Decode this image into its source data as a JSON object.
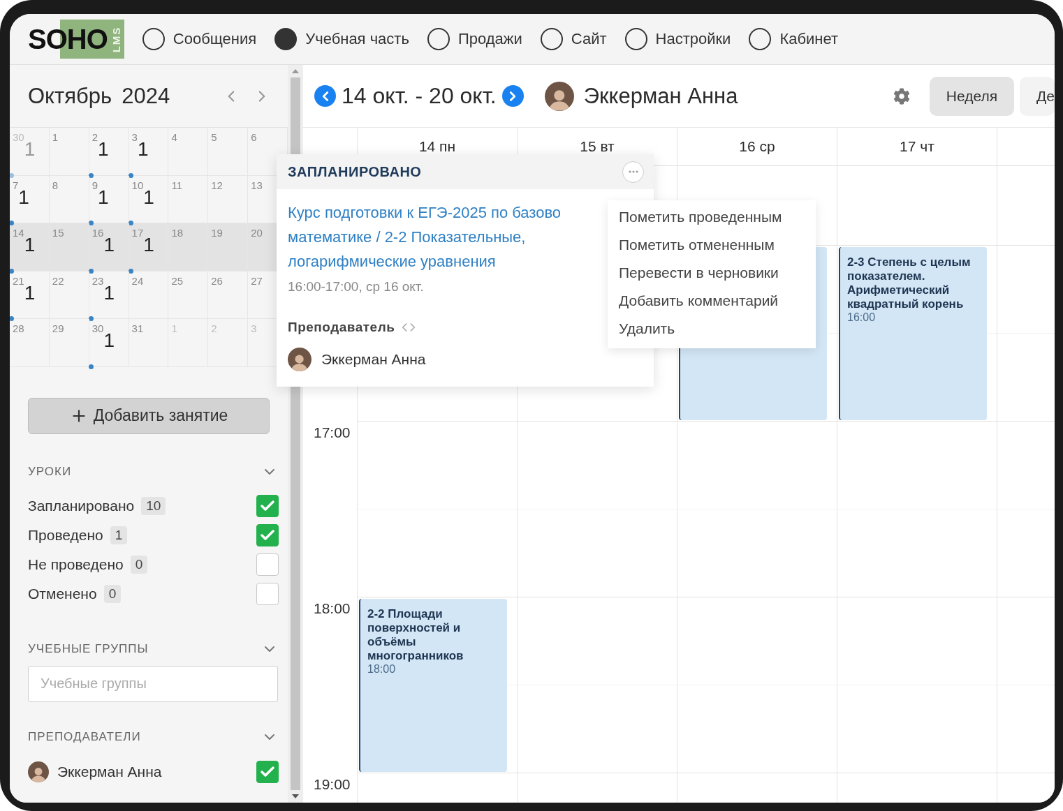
{
  "nav": {
    "logo": "SOHO",
    "logo_sub": "LMS",
    "items": [
      {
        "label": "Сообщения",
        "selected": false
      },
      {
        "label": "Учебная часть",
        "selected": true
      },
      {
        "label": "Продажи",
        "selected": false
      },
      {
        "label": "Сайт",
        "selected": false
      },
      {
        "label": "Настройки",
        "selected": false
      },
      {
        "label": "Кабинет",
        "selected": false
      }
    ]
  },
  "sidebar": {
    "month": "Октябрь",
    "year": "2024",
    "weeks": [
      {
        "selected": false,
        "days": [
          {
            "day": "30",
            "outside": true,
            "count": "1"
          },
          {
            "day": "1",
            "outside": false
          },
          {
            "day": "2",
            "outside": false,
            "count": "1"
          },
          {
            "day": "3",
            "outside": false,
            "count": "1"
          },
          {
            "day": "4",
            "outside": false
          },
          {
            "day": "5",
            "outside": false
          },
          {
            "day": "6",
            "outside": false
          }
        ]
      },
      {
        "selected": false,
        "days": [
          {
            "day": "7",
            "outside": false,
            "count": "1"
          },
          {
            "day": "8",
            "outside": false
          },
          {
            "day": "9",
            "outside": false,
            "count": "1"
          },
          {
            "day": "10",
            "outside": false,
            "count": "1"
          },
          {
            "day": "11",
            "outside": false
          },
          {
            "day": "12",
            "outside": false
          },
          {
            "day": "13",
            "outside": false
          }
        ]
      },
      {
        "selected": true,
        "days": [
          {
            "day": "14",
            "outside": false,
            "count": "1"
          },
          {
            "day": "15",
            "outside": false
          },
          {
            "day": "16",
            "outside": false,
            "count": "1"
          },
          {
            "day": "17",
            "outside": false,
            "count": "1"
          },
          {
            "day": "18",
            "outside": false
          },
          {
            "day": "19",
            "outside": false
          },
          {
            "day": "20",
            "outside": false
          }
        ]
      },
      {
        "selected": false,
        "days": [
          {
            "day": "21",
            "outside": false,
            "count": "1"
          },
          {
            "day": "22",
            "outside": false
          },
          {
            "day": "23",
            "outside": false,
            "count": "1"
          },
          {
            "day": "24",
            "outside": false
          },
          {
            "day": "25",
            "outside": false
          },
          {
            "day": "26",
            "outside": false
          },
          {
            "day": "27",
            "outside": false
          }
        ]
      },
      {
        "selected": false,
        "days": [
          {
            "day": "28",
            "outside": false
          },
          {
            "day": "29",
            "outside": false
          },
          {
            "day": "30",
            "outside": false,
            "count": "1"
          },
          {
            "day": "31",
            "outside": false
          },
          {
            "day": "1",
            "outside": true
          },
          {
            "day": "2",
            "outside": true
          },
          {
            "day": "3",
            "outside": true
          }
        ]
      }
    ],
    "add_button": "Добавить занятие",
    "lessons": {
      "title": "УРОКИ",
      "filters": [
        {
          "label": "Запланировано",
          "count": "10",
          "checked": true
        },
        {
          "label": "Проведено",
          "count": "1",
          "checked": true
        },
        {
          "label": "Не проведено",
          "count": "0",
          "checked": false
        },
        {
          "label": "Отменено",
          "count": "0",
          "checked": false
        }
      ]
    },
    "groups": {
      "title": "УЧЕБНЫЕ ГРУППЫ",
      "placeholder": "Учебные группы"
    },
    "teachers": {
      "title": "ПРЕПОДАВАТЕЛИ",
      "items": [
        {
          "name": "Эккерман Анна",
          "checked": true
        }
      ]
    }
  },
  "header": {
    "range": "14 окт. - 20 окт.",
    "teacher": "Эккерман Анна",
    "views": [
      {
        "label": "Неделя",
        "selected": true
      },
      {
        "label": "Де",
        "selected": false
      }
    ]
  },
  "calendar": {
    "time_labels": [
      "17:00",
      "18:00",
      "19:00"
    ],
    "days": [
      {
        "label": "14 пн",
        "events": [
          {
            "title": "2-2 Площади поверхностей и объёмы многогранников",
            "time": "18:00",
            "kind": "text"
          }
        ]
      },
      {
        "label": "15 вт"
      },
      {
        "label": "16 ср",
        "events": [
          {
            "kind": "blank"
          }
        ]
      },
      {
        "label": "17 чт",
        "events": [
          {
            "title": "2-3 Степень с целым показателем. Арифметический квадратный корень",
            "time": "16:00",
            "kind": "text"
          }
        ]
      }
    ]
  },
  "popup": {
    "status": "ЗАПЛАНИРОВАНО",
    "title_lines": [
      "Курс подготовки к ЕГЭ-2025 по базово",
      "математике / 2-2 Показательные,",
      "логарифмические уравнения"
    ],
    "time": "16:00-17:00, ср 16 окт.",
    "teacher_label": "Преподаватель",
    "teacher": "Эккерман Анна"
  },
  "menu": [
    "Пометить проведенным",
    "Пометить отмененным",
    "Перевести в черновики",
    "Добавить комментарий",
    "Удалить"
  ]
}
